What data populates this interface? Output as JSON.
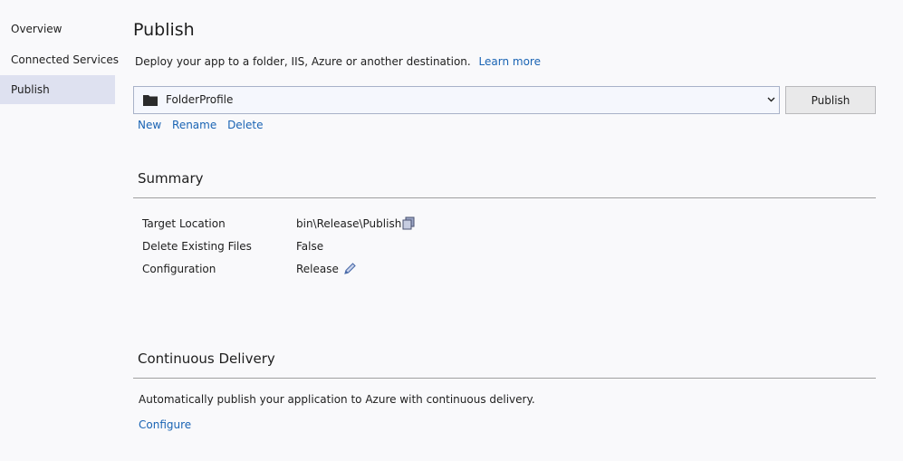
{
  "sidebar": {
    "items": [
      {
        "label": "Overview"
      },
      {
        "label": "Connected Services"
      },
      {
        "label": "Publish"
      }
    ]
  },
  "page": {
    "title": "Publish",
    "description": "Deploy your app to a folder, IIS, Azure or another destination.",
    "learn_more": "Learn more"
  },
  "profile": {
    "selected": "FolderProfile",
    "publish_button": "Publish",
    "actions": {
      "new": "New",
      "rename": "Rename",
      "delete": "Delete"
    }
  },
  "summary": {
    "header": "Summary",
    "rows": [
      {
        "label": "Target Location",
        "value": "bin\\Release\\Publish",
        "icon": "copy-icon"
      },
      {
        "label": "Delete Existing Files",
        "value": "False"
      },
      {
        "label": "Configuration",
        "value": "Release",
        "icon": "edit-pencil-icon"
      }
    ]
  },
  "continuous_delivery": {
    "header": "Continuous Delivery",
    "description": "Automatically publish your application to Azure with continuous delivery.",
    "configure": "Configure"
  },
  "colors": {
    "link": "#1a64b4",
    "sidebar_active": "#dee1f0",
    "background": "#f9f9fb"
  }
}
